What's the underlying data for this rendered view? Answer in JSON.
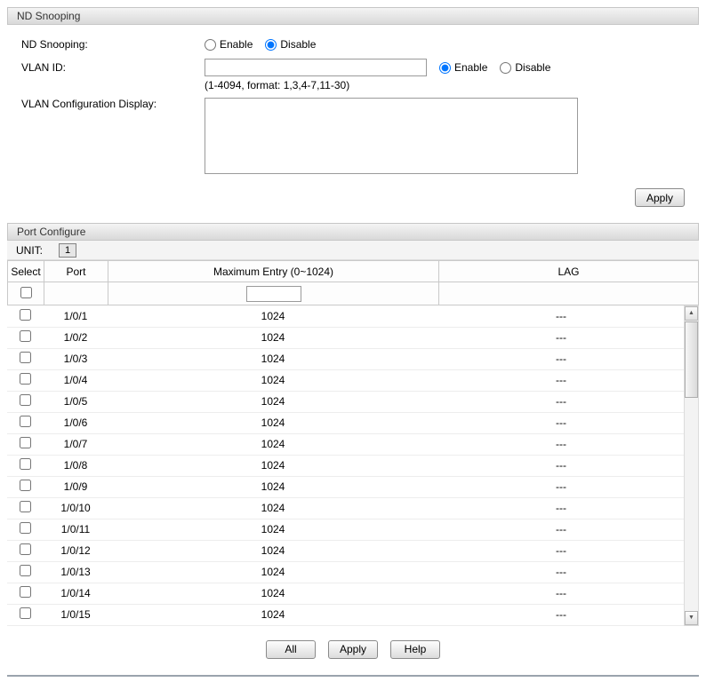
{
  "nd_snooping": {
    "title": "ND Snooping",
    "label": "ND Snooping:",
    "enable_label": "Enable",
    "disable_label": "Disable",
    "selected": "Disable",
    "vlan_id": {
      "label": "VLAN ID:",
      "value": "",
      "enable_label": "Enable",
      "disable_label": "Disable",
      "selected": "Enable",
      "hint": "(1-4094, format: 1,3,4-7,11-30)"
    },
    "vlan_config_display": {
      "label": "VLAN Configuration Display:",
      "value": ""
    },
    "apply_label": "Apply"
  },
  "port_configure": {
    "title": "Port Configure",
    "unit_label": "UNIT:",
    "unit_selected": "1",
    "columns": {
      "select": "Select",
      "port": "Port",
      "max_entry": "Maximum Entry (0~1024)",
      "lag": "LAG"
    },
    "filter": {
      "max_entry_value": ""
    },
    "rows": [
      {
        "port": "1/0/1",
        "max_entry": "1024",
        "lag": "---"
      },
      {
        "port": "1/0/2",
        "max_entry": "1024",
        "lag": "---"
      },
      {
        "port": "1/0/3",
        "max_entry": "1024",
        "lag": "---"
      },
      {
        "port": "1/0/4",
        "max_entry": "1024",
        "lag": "---"
      },
      {
        "port": "1/0/5",
        "max_entry": "1024",
        "lag": "---"
      },
      {
        "port": "1/0/6",
        "max_entry": "1024",
        "lag": "---"
      },
      {
        "port": "1/0/7",
        "max_entry": "1024",
        "lag": "---"
      },
      {
        "port": "1/0/8",
        "max_entry": "1024",
        "lag": "---"
      },
      {
        "port": "1/0/9",
        "max_entry": "1024",
        "lag": "---"
      },
      {
        "port": "1/0/10",
        "max_entry": "1024",
        "lag": "---"
      },
      {
        "port": "1/0/11",
        "max_entry": "1024",
        "lag": "---"
      },
      {
        "port": "1/0/12",
        "max_entry": "1024",
        "lag": "---"
      },
      {
        "port": "1/0/13",
        "max_entry": "1024",
        "lag": "---"
      },
      {
        "port": "1/0/14",
        "max_entry": "1024",
        "lag": "---"
      },
      {
        "port": "1/0/15",
        "max_entry": "1024",
        "lag": "---"
      }
    ],
    "footer_buttons": {
      "all": "All",
      "apply": "Apply",
      "help": "Help"
    },
    "scrollbar": {
      "up_glyph": "▲",
      "down_glyph": "▼"
    }
  }
}
